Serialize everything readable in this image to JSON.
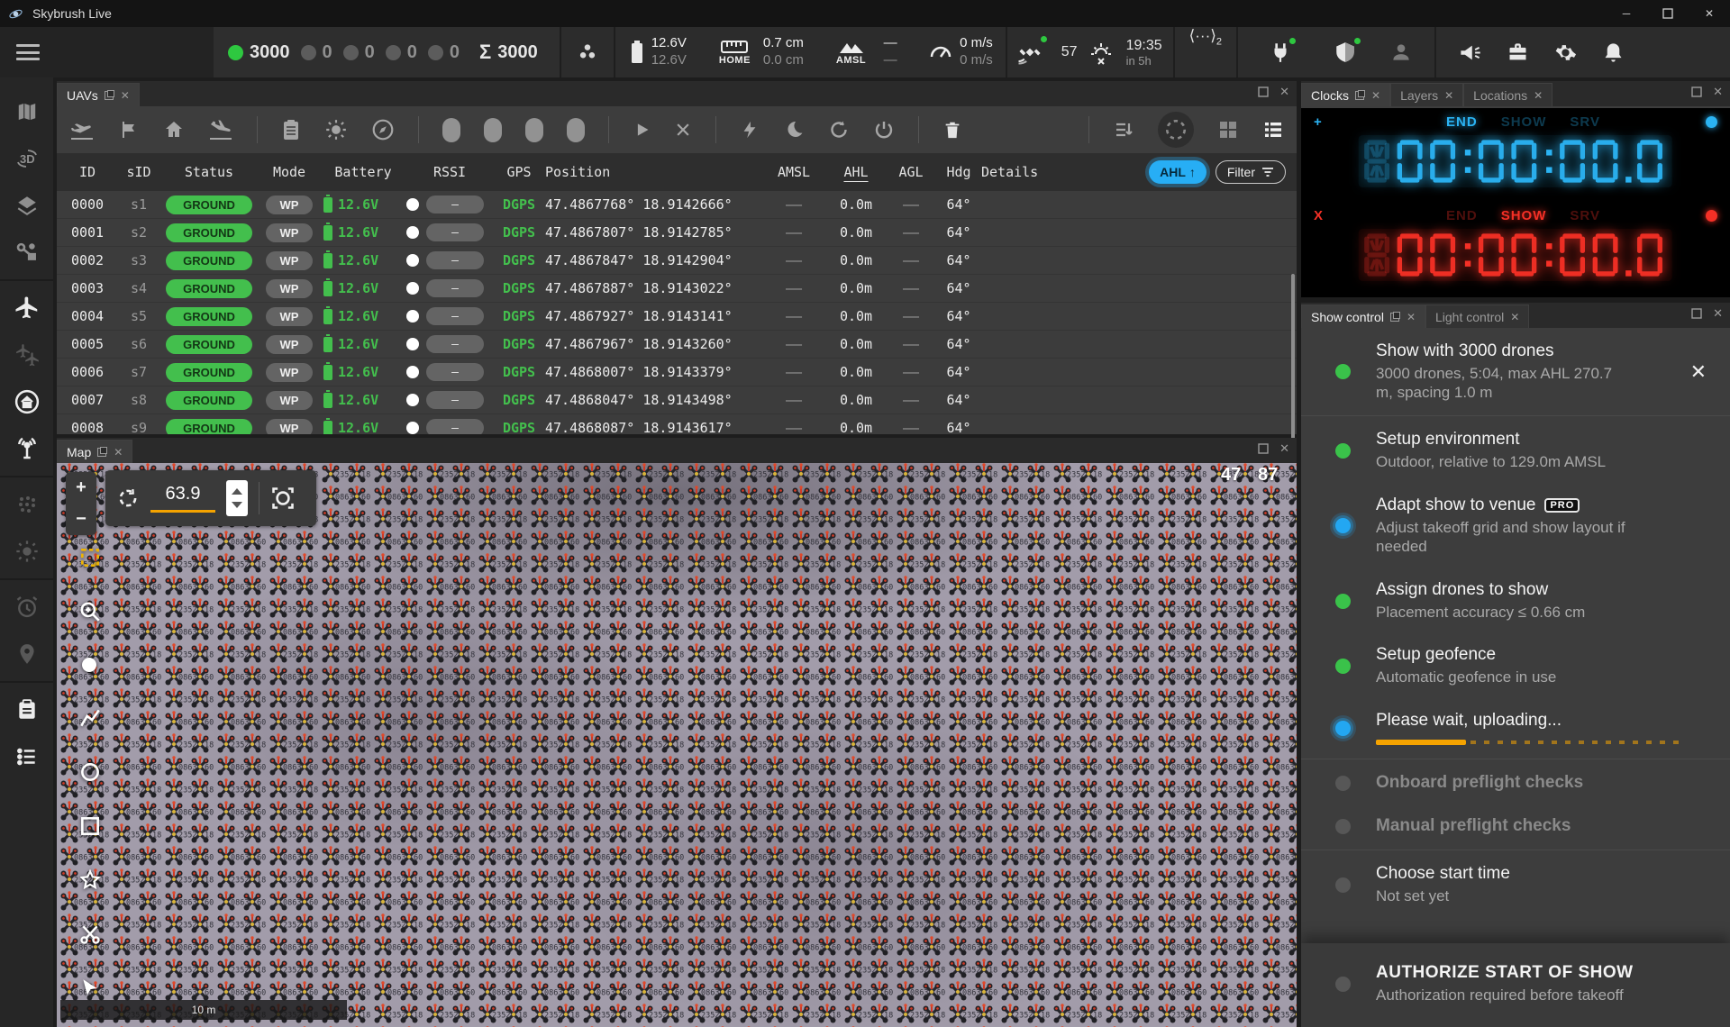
{
  "window": {
    "title": "Skybrush Live"
  },
  "header": {
    "counts": {
      "active": "3000",
      "zeros": [
        "0",
        "0",
        "0",
        "0"
      ],
      "total": "3000"
    },
    "battery": {
      "top": "12.6V",
      "bottom": "12.6V"
    },
    "home": {
      "label": "HOME",
      "top": "0.7 cm",
      "bottom": "0.0 cm"
    },
    "amsl": {
      "label": "AMSL",
      "top": "—",
      "bottom": "—"
    },
    "speed": {
      "top": "0 m/s",
      "bottom": "0 m/s"
    },
    "gps": {
      "satellites": "57"
    },
    "clock": {
      "time": "19:35",
      "sub": "in 5h"
    },
    "rtk": {
      "sub": "2"
    }
  },
  "accent": {
    "green": "#3ac24a",
    "blue": "#23a7f2",
    "orange": "#f5a300",
    "clock_blue": "#2bb3f3",
    "clock_red": "#f53026"
  },
  "uavs": {
    "tab": "UAVs",
    "columns": [
      "ID",
      "sID",
      "Status",
      "Mode",
      "Battery",
      "RSSI",
      "GPS",
      "Position",
      "AMSL",
      "AHL",
      "AGL",
      "Hdg",
      "Details"
    ],
    "sort_chip": "AHL",
    "filter_chip": "Filter",
    "rows": [
      {
        "id": "0000",
        "sid": "s1",
        "status": "GROUND",
        "mode": "WP",
        "battery": "12.6V",
        "rssi": "–",
        "gps": "DGPS",
        "pos": "47.4867768° 18.9142666°",
        "amsl": "——",
        "ahl": "0.0m",
        "agl": "——",
        "hdg": "64°"
      },
      {
        "id": "0001",
        "sid": "s2",
        "status": "GROUND",
        "mode": "WP",
        "battery": "12.6V",
        "rssi": "–",
        "gps": "DGPS",
        "pos": "47.4867807° 18.9142785°",
        "amsl": "——",
        "ahl": "0.0m",
        "agl": "——",
        "hdg": "64°"
      },
      {
        "id": "0002",
        "sid": "s3",
        "status": "GROUND",
        "mode": "WP",
        "battery": "12.6V",
        "rssi": "–",
        "gps": "DGPS",
        "pos": "47.4867847° 18.9142904°",
        "amsl": "——",
        "ahl": "0.0m",
        "agl": "——",
        "hdg": "64°"
      },
      {
        "id": "0003",
        "sid": "s4",
        "status": "GROUND",
        "mode": "WP",
        "battery": "12.6V",
        "rssi": "–",
        "gps": "DGPS",
        "pos": "47.4867887° 18.9143022°",
        "amsl": "——",
        "ahl": "0.0m",
        "agl": "——",
        "hdg": "64°"
      },
      {
        "id": "0004",
        "sid": "s5",
        "status": "GROUND",
        "mode": "WP",
        "battery": "12.6V",
        "rssi": "–",
        "gps": "DGPS",
        "pos": "47.4867927° 18.9143141°",
        "amsl": "——",
        "ahl": "0.0m",
        "agl": "——",
        "hdg": "64°"
      },
      {
        "id": "0005",
        "sid": "s6",
        "status": "GROUND",
        "mode": "WP",
        "battery": "12.6V",
        "rssi": "–",
        "gps": "DGPS",
        "pos": "47.4867967° 18.9143260°",
        "amsl": "——",
        "ahl": "0.0m",
        "agl": "——",
        "hdg": "64°"
      },
      {
        "id": "0006",
        "sid": "s7",
        "status": "GROUND",
        "mode": "WP",
        "battery": "12.6V",
        "rssi": "–",
        "gps": "DGPS",
        "pos": "47.4868007° 18.9143379°",
        "amsl": "——",
        "ahl": "0.0m",
        "agl": "——",
        "hdg": "64°"
      },
      {
        "id": "0007",
        "sid": "s8",
        "status": "GROUND",
        "mode": "WP",
        "battery": "12.6V",
        "rssi": "–",
        "gps": "DGPS",
        "pos": "47.4868047° 18.9143498°",
        "amsl": "——",
        "ahl": "0.0m",
        "agl": "——",
        "hdg": "64°"
      },
      {
        "id": "0008",
        "sid": "s9",
        "status": "GROUND",
        "mode": "WP",
        "battery": "12.6V",
        "rssi": "–",
        "gps": "DGPS",
        "pos": "47.4868087° 18.9143617°",
        "amsl": "——",
        "ahl": "0.0m",
        "agl": "——",
        "hdg": "64°"
      }
    ]
  },
  "map": {
    "tab": "Map",
    "rotation": "63.9",
    "scale": "10 m",
    "labels": [
      "47",
      "87"
    ],
    "marker_numbers": [
      "2352",
      "1852",
      "0863",
      "6058"
    ]
  },
  "clocks": {
    "tabs": [
      "Clocks",
      "Layers",
      "Locations"
    ],
    "clock1": {
      "sign": "+",
      "labels": [
        "END",
        "SHOW",
        "SRV"
      ],
      "active": "END",
      "time": "00:00:00.0"
    },
    "clock2": {
      "sign": "X",
      "labels": [
        "END",
        "SHOW",
        "SRV"
      ],
      "active": "SHOW",
      "time": "00:00:00.0"
    }
  },
  "show": {
    "tabs": [
      "Show control",
      "Light control"
    ],
    "steps": [
      {
        "title": "Show with 3000 drones",
        "subtitle": "3000 drones, 5:04, max AHL 270.7 m, spacing 1.0 m",
        "state": "green",
        "closable": true,
        "divider_after": true
      },
      {
        "title": "Setup environment",
        "subtitle": "Outdoor, relative to 129.0m AMSL",
        "state": "green"
      },
      {
        "title": "Adapt show to venue",
        "subtitle": "Adjust takeoff grid and show layout if needed",
        "state": "blue",
        "badge": "PRO"
      },
      {
        "title": "Assign drones to show",
        "subtitle": "Placement accuracy ≤ 0.66 cm",
        "state": "green"
      },
      {
        "title": "Setup geofence",
        "subtitle": "Automatic geofence in use",
        "state": "green"
      },
      {
        "title": "Please wait, uploading...",
        "state": "blue",
        "progress": 0.29,
        "divider_after": true
      },
      {
        "title": "Onboard preflight checks",
        "state": "disabled"
      },
      {
        "title": "Manual preflight checks",
        "state": "disabled",
        "divider_after": true
      },
      {
        "title": "Choose start time",
        "subtitle": "Not set yet",
        "state": "gray"
      },
      {
        "title": "AUTHORIZE START OF SHOW",
        "subtitle": "Authorization required before takeoff",
        "state": "gray",
        "card": true
      }
    ]
  }
}
